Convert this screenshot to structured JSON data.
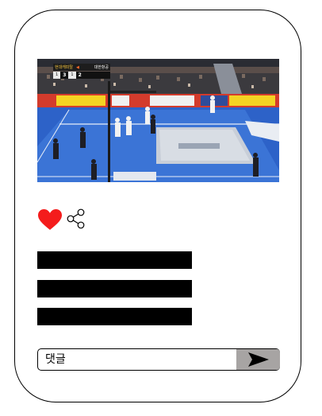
{
  "post": {
    "video": {
      "scoreboard": {
        "team_home": "현대캐피탈",
        "team_away": "대한항공",
        "home_points": "3",
        "away_points": "2",
        "home_sets": "1",
        "away_sets": "1"
      },
      "ads": [
        "BESKO",
        "BESKO",
        "BESKO"
      ]
    },
    "actions": {
      "like_icon": "heart-icon",
      "share_icon": "share-icon",
      "like_color": "#f41c1c"
    }
  },
  "comment": {
    "placeholder": "댓글",
    "send_icon": "send-arrow-icon"
  },
  "colors": {
    "send_button_bg": "#a7a4a3",
    "court_blue": "#2b58b8"
  }
}
